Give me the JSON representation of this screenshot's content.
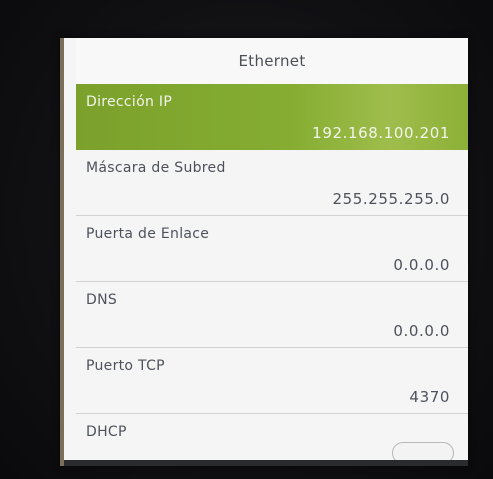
{
  "header": {
    "title": "Ethernet"
  },
  "settings": {
    "ip": {
      "label": "Dirección IP",
      "value": "192.168.100.201"
    },
    "mask": {
      "label": "Máscara de Subred",
      "value": "255.255.255.0"
    },
    "gateway": {
      "label": "Puerta de Enlace",
      "value": "0.0.0.0"
    },
    "dns": {
      "label": "DNS",
      "value": "0.0.0.0"
    },
    "port": {
      "label": "Puerto TCP",
      "value": "4370"
    },
    "dhcp": {
      "label": "DHCP",
      "enabled": false
    }
  },
  "colors": {
    "selected_row": "#86ad32",
    "screen_background": "#f4f5f4",
    "text": "#4d525c"
  }
}
